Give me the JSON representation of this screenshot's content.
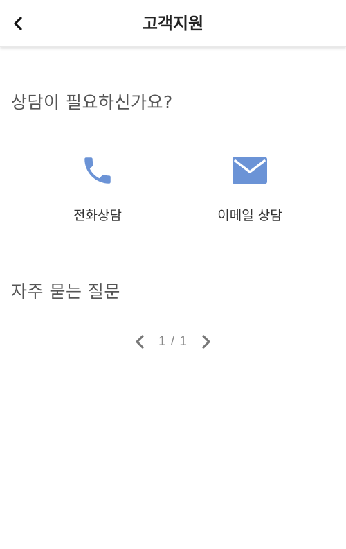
{
  "header": {
    "title": "고객지원",
    "back_icon": "chevron-left-icon"
  },
  "consult": {
    "title": "상담이 필요하신가요?",
    "options": [
      {
        "label": "전화상담",
        "icon": "phone-icon",
        "icon_color": "#6b93d6"
      },
      {
        "label": "이메일 상담",
        "icon": "mail-icon",
        "icon_color": "#6b93d6"
      }
    ]
  },
  "faq": {
    "title": "자주 묻는 질문",
    "pager": {
      "text": "1 / 1",
      "prev_icon": "chevron-left-icon",
      "next_icon": "chevron-right-icon"
    }
  }
}
